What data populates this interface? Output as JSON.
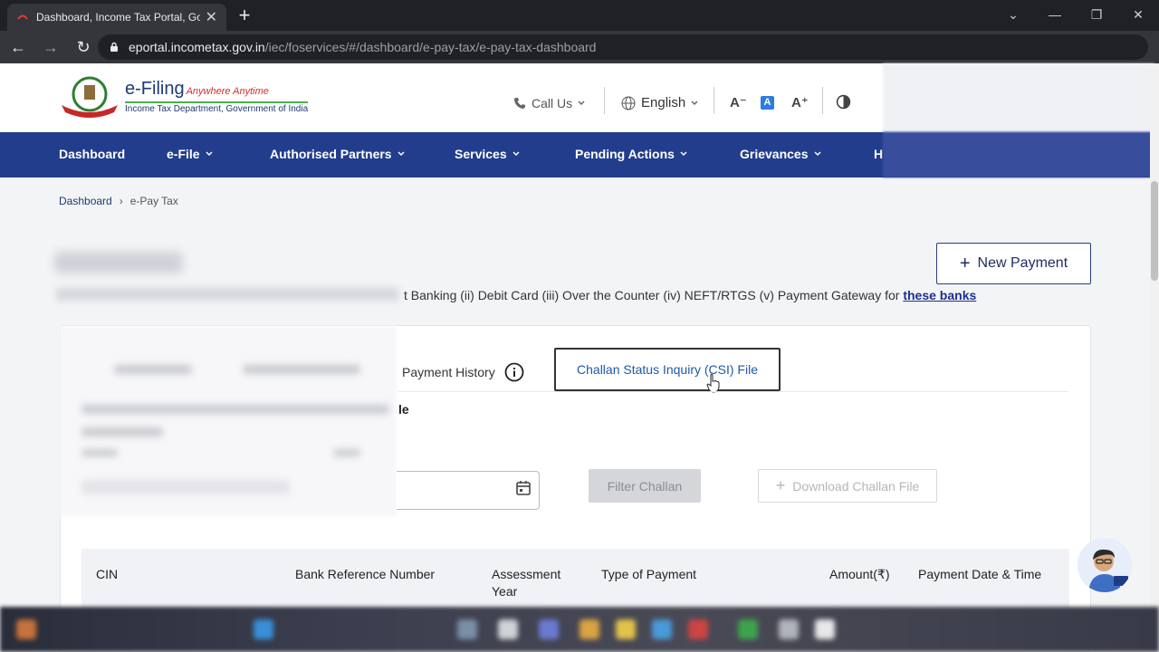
{
  "browser": {
    "tab_title": "Dashboard, Income Tax Portal, Go",
    "tab_close": "✕",
    "new_tab": "+",
    "url_host": "eportal.incometax.gov.in",
    "url_path": "/iec/foservices/#/dashboard/e-pay-tax/e-pay-tax-dashboard"
  },
  "header": {
    "brand_title": "e-Filing",
    "brand_tagline": "Anywhere Anytime",
    "brand_subtitle": "Income Tax Department, Government of India",
    "call_us": "Call Us",
    "language": "English",
    "font_decrease": "A⁻",
    "font_normal": "A",
    "font_increase": "A⁺"
  },
  "nav": {
    "items": [
      {
        "label": "Dashboard"
      },
      {
        "label": "e-File"
      },
      {
        "label": "Authorised Partners"
      },
      {
        "label": "Services"
      },
      {
        "label": "Pending Actions"
      },
      {
        "label": "Grievances"
      },
      {
        "label": "H"
      }
    ]
  },
  "breadcrumb": {
    "root": "Dashboard",
    "separator": "›",
    "current": "e-Pay Tax"
  },
  "page": {
    "description_visible": "t Banking (ii) Debit Card (iii) Over the Counter (iv) NEFT/RTGS (v) Payment Gateway for ",
    "description_link": "these banks",
    "new_payment_icon": "+",
    "new_payment_label": "New Payment"
  },
  "tabs": {
    "payment_history": "Payment History",
    "csi_file": "Challan Status Inquiry (CSI) File",
    "partial_label_suffix": "le"
  },
  "filters": {
    "filter_button": "Filter Challan",
    "download_icon": "+",
    "download_button": "Download Challan File"
  },
  "table": {
    "columns": [
      "CIN",
      "Bank Reference Number",
      "Assessment Year",
      "Type of Payment",
      "Amount(₹)",
      "Payment Date & Time"
    ]
  },
  "colors": {
    "nav_bg": "#223d8c",
    "link": "#1c2f8f",
    "accent_blue": "#1c5aa8"
  }
}
